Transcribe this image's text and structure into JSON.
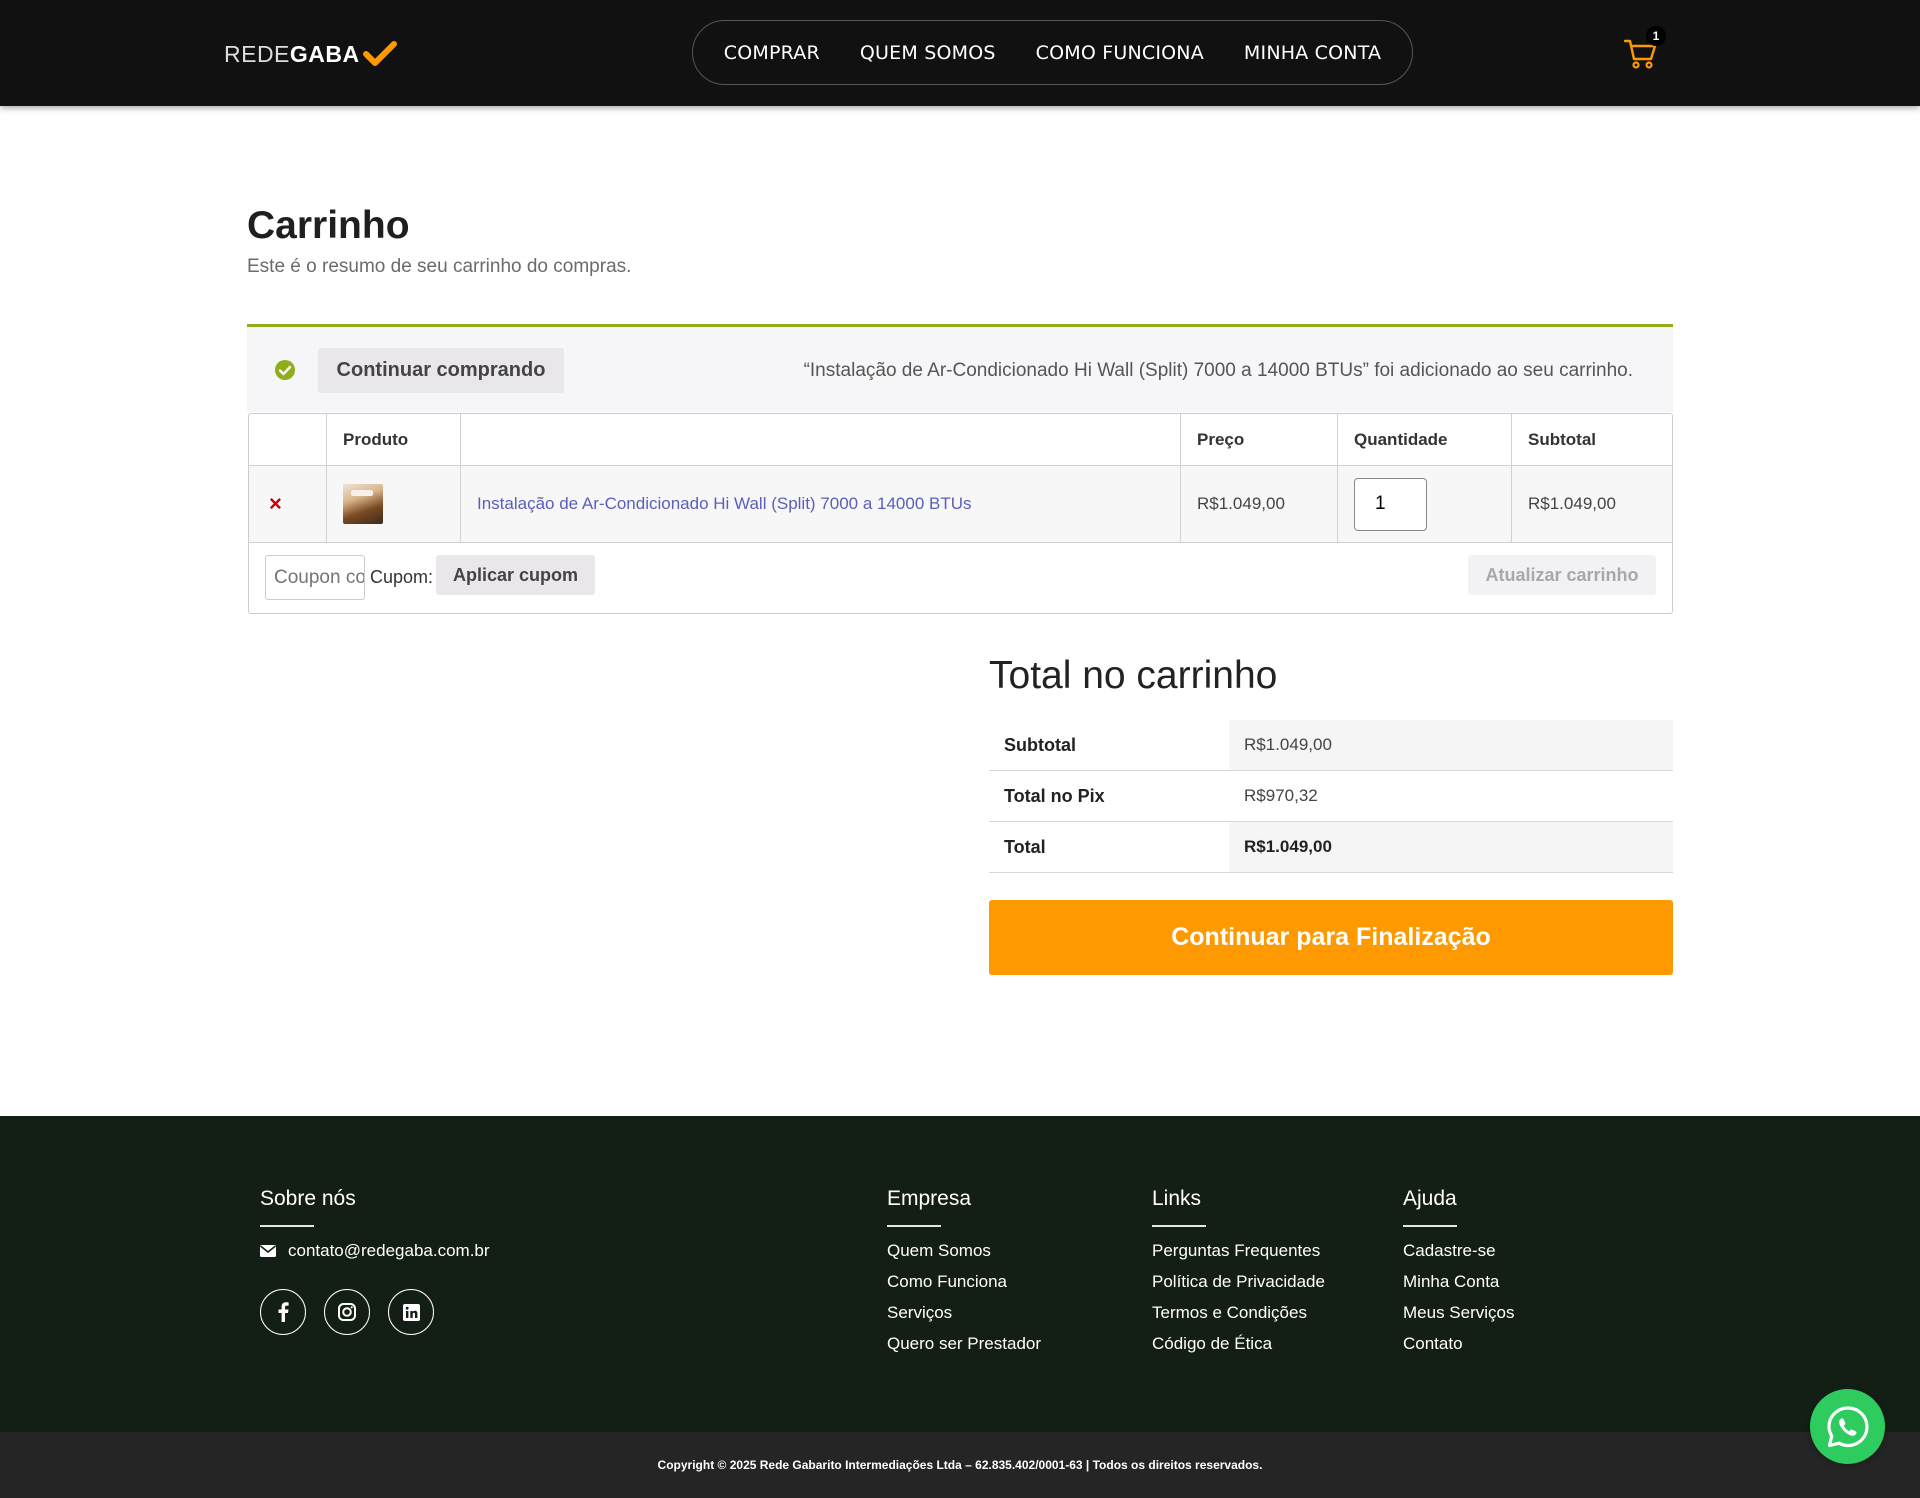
{
  "header": {
    "logo_thin": "REDE",
    "logo_bold": "GABA",
    "nav": [
      "COMPRAR",
      "QUEM SOMOS",
      "COMO FUNCIONA",
      "MINHA CONTA"
    ],
    "cart_count": "1"
  },
  "page": {
    "title": "Carrinho",
    "subtitle": "Este é o resumo de seu carrinho do compras."
  },
  "notice": {
    "button": "Continuar comprando",
    "message": "“Instalação de Ar-Condicionado Hi Wall (Split) 7000 a 14000 BTUs” foi adicionado ao seu carrinho."
  },
  "cart_table": {
    "headers": [
      "",
      "Produto",
      "",
      "Preço",
      "Quantidade",
      "Subtotal"
    ],
    "items": [
      {
        "remove": "×",
        "name": "Instalação de Ar-Condicionado Hi Wall (Split) 7000 a 14000 BTUs",
        "price": "R$1.049,00",
        "quantity": "1",
        "subtotal": "R$1.049,00"
      }
    ],
    "coupon_placeholder": "Coupon code",
    "coupon_label": "Cupom:",
    "apply_coupon": "Aplicar cupom",
    "update_cart": "Atualizar carrinho"
  },
  "totals": {
    "title": "Total no carrinho",
    "rows": [
      {
        "label": "Subtotal",
        "value": "R$1.049,00"
      },
      {
        "label": "Total no Pix",
        "value": "R$970,32"
      },
      {
        "label": "Total",
        "value": "R$1.049,00"
      }
    ],
    "checkout_button": "Continuar para Finalização"
  },
  "footer": {
    "about": {
      "title": "Sobre nós",
      "email": "contato@redegaba.com.br"
    },
    "empresa": {
      "title": "Empresa",
      "links": [
        "Quem Somos",
        "Como Funciona",
        "Serviços",
        "Quero ser Prestador"
      ]
    },
    "links": {
      "title": "Links",
      "links": [
        "Perguntas Frequentes",
        "Política de Privacidade",
        "Termos e Condições",
        "Código de Ética"
      ]
    },
    "ajuda": {
      "title": "Ajuda",
      "links": [
        "Cadastre-se",
        "Minha Conta",
        "Meus Serviços",
        "Contato"
      ]
    },
    "copyright": "Copyright © 2025 Rede Gabarito Intermediações Ltda – 62.835.402/0001-63 | Todos os direitos reservados."
  },
  "colors": {
    "accent": "#ff9900",
    "notice_border": "#8fae1b",
    "footer_bg": "#131e14",
    "whatsapp": "#2ecc5f"
  },
  "icons": [
    "logo-check-icon",
    "cart-icon",
    "success-check-icon",
    "remove-icon",
    "envelope-icon",
    "facebook-icon",
    "instagram-icon",
    "linkedin-icon",
    "whatsapp-icon"
  ]
}
